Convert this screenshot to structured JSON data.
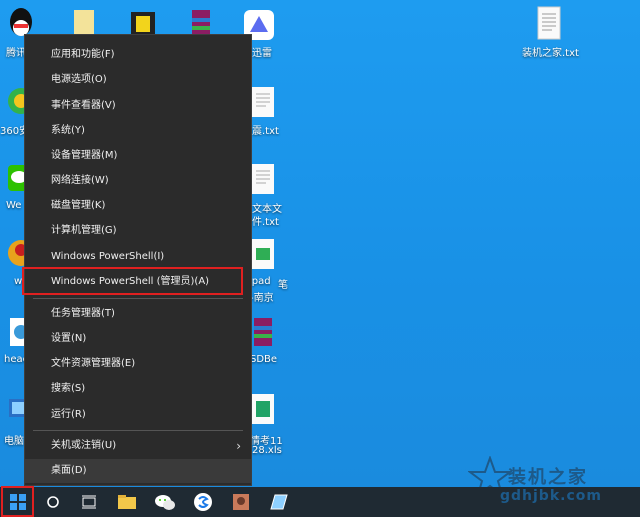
{
  "desktop": {
    "left_labels": [
      "腾讯",
      "360安",
      "We",
      "w",
      "heac",
      "电脑"
    ],
    "right_labels": [
      "迅雷",
      "震.txt",
      "文本文",
      "件.txt",
      "kpad",
      "笔",
      "-南京",
      "SDBe",
      "情考11",
      "28.xls"
    ],
    "top_right_file": "装机之家.txt"
  },
  "menu": {
    "items": [
      "应用和功能(F)",
      "电源选项(O)",
      "事件查看器(V)",
      "系统(Y)",
      "设备管理器(M)",
      "网络连接(W)",
      "磁盘管理(K)",
      "计算机管理(G)",
      "Windows PowerShell(I)",
      "Windows PowerShell (管理员)(A)",
      "任务管理器(T)",
      "设置(N)",
      "文件资源管理器(E)",
      "搜索(S)",
      "运行(R)",
      "关机或注销(U)",
      "桌面(D)"
    ]
  },
  "watermark": {
    "title": "装机之家",
    "url": "gdhjbk.com"
  },
  "colors": {
    "menu_bg": "#2b2b2b",
    "highlight": "#e02020",
    "desktop": "#1e9cf0",
    "taskbar": "#1f2a33"
  }
}
